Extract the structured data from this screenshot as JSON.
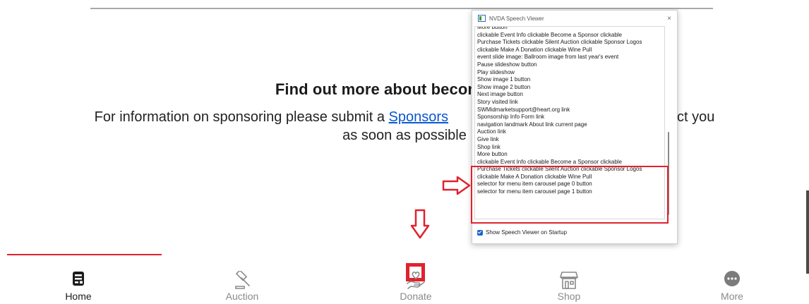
{
  "page": {
    "heading": "Find out more about becoming a C",
    "paragraph": {
      "before": "For information on sponsoring please submit a ",
      "link": "Sponsors",
      "after_gap": "l contact you",
      "line2": "as soon as possible"
    }
  },
  "speech_viewer": {
    "title": "NVDA Speech Viewer",
    "close_glyph": "×",
    "lines": [
      "More button",
      "clickable  Event Info  clickable  Become a Sponsor  clickable",
      "Purchase Tickets  clickable  Silent Auction  clickable  Sponsor Logos",
      "clickable  Make A Donation  clickable  Wine Pull",
      "event slide image: Ballroom image from last year's event",
      "Pause slideshow  button",
      "Play slideshow",
      "Show image 1  button",
      "Show image 2  button",
      "Next image  button",
      "Story  visited  link",
      "SWMidmarketsupport@heart.org  link",
      "Sponsorship Info Form  link",
      "navigation landmark   About  link    current page",
      "Auction  link",
      "Give  link",
      "Shop  link",
      "More  button",
      "clickable  Event Info  clickable  Become a Sponsor  clickable",
      "Purchase Tickets  clickable  Silent Auction  clickable  Sponsor Logos",
      "clickable  Make A Donation  clickable  Wine Pull",
      "selector for menu item carousel page 0  button",
      "selector for menu item carousel page 1  button"
    ],
    "startup_checkbox_label": "Show Speech Viewer on Startup",
    "startup_checked": true
  },
  "nav": {
    "items": [
      {
        "label": "Home",
        "icon": "home-icon",
        "active": true
      },
      {
        "label": "Auction",
        "icon": "gavel-icon",
        "active": false
      },
      {
        "label": "Donate",
        "icon": "heart-hand-icon",
        "active": false
      },
      {
        "label": "Shop",
        "icon": "storefront-icon",
        "active": false
      },
      {
        "label": "More",
        "icon": "more-icon",
        "active": false
      }
    ]
  },
  "colors": {
    "annotation_red": "#e0222e",
    "link_blue": "#0b57d0",
    "nav_inactive": "#8a8a8a",
    "nav_active": "#1b1b1b"
  }
}
